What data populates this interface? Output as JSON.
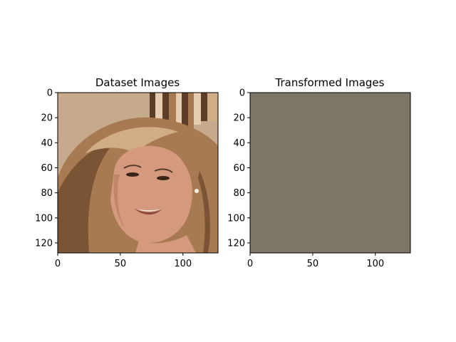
{
  "chart_data": [
    {
      "type": "image",
      "title": "Dataset Images",
      "content": "portrait photo of a smiling woman with long light-brown hair",
      "xlim": [
        0,
        128
      ],
      "ylim": [
        128,
        0
      ],
      "xticks": [
        0,
        50,
        100
      ],
      "yticks": [
        0,
        20,
        40,
        60,
        80,
        100,
        120
      ],
      "palette": {
        "background": "#c7a98c",
        "hair_dark": "#7a5434",
        "hair_mid": "#a77a52",
        "hair_light": "#d1ad86",
        "skin": "#d59a7e",
        "skin_shadow": "#b87e62",
        "mouth": "#8e4a3e",
        "teeth": "#f1e7de",
        "eye": "#3a2418",
        "stripe_dark": "#5d3d28",
        "stripe_light": "#e6cdb1"
      }
    },
    {
      "type": "image",
      "title": "Transformed Images",
      "content": "uniform solid color",
      "fill": "#7d7566",
      "xlim": [
        0,
        128
      ],
      "ylim": [
        128,
        0
      ],
      "xticks": [
        0,
        50,
        100
      ],
      "yticks": [
        0,
        20,
        40,
        60,
        80,
        100,
        120
      ]
    }
  ]
}
